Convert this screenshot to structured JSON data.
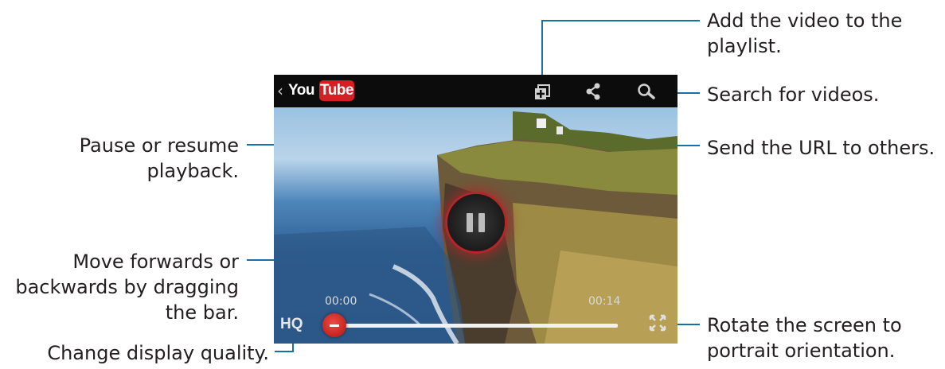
{
  "player": {
    "header": {
      "back_glyph": "‹",
      "logo_you": "You",
      "logo_tube": "Tube",
      "icons": [
        "add-to-playlist-icon",
        "share-icon",
        "search-icon"
      ]
    },
    "pause_icon": "pause-icon",
    "elapsed": "00:00",
    "duration": "00:14",
    "progress": 0,
    "quality_label": "HQ",
    "rotate_icon": "rotate-screen-icon"
  },
  "callouts": {
    "playlist": [
      "Add the video to the",
      "playlist."
    ],
    "search": "Search for videos.",
    "share": "Send the URL to others.",
    "rotate": [
      "Rotate the screen to",
      "portrait orientation."
    ],
    "pause": [
      "Pause or resume",
      "playback."
    ],
    "seek": [
      "Move forwards or",
      "backwards by dragging",
      "the bar."
    ],
    "quality": "Change display quality."
  },
  "colors": {
    "callout_line": "#1b6fa8",
    "youtube_red": "#d51f22",
    "header_bg": "#0c0c0c"
  }
}
